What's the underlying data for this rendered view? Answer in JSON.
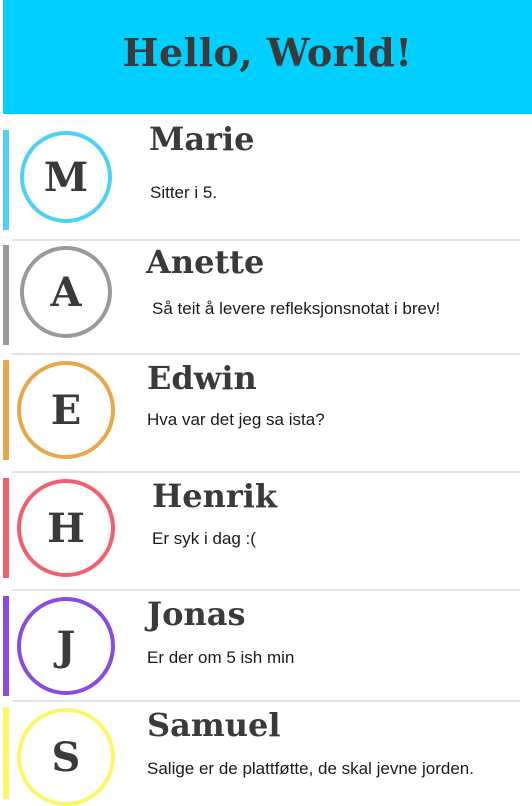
{
  "header": {
    "title": "Hello, World!"
  },
  "contacts": [
    {
      "initial": "M",
      "name": "Marie",
      "message": "Sitter i 5.",
      "color": "#4fd0f5"
    },
    {
      "initial": "A",
      "name": "Anette",
      "message": "Så teit å levere refleksjonsnotat i brev!",
      "color": "#9a9a9a"
    },
    {
      "initial": "E",
      "name": "Edwin",
      "message": "Hva var det jeg sa ista?",
      "color": "#e8a84a"
    },
    {
      "initial": "H",
      "name": "Henrik",
      "message": "Er syk i dag :(",
      "color": "#f2606e"
    },
    {
      "initial": "J",
      "name": "Jonas",
      "message": "Er der om 5 ish min",
      "color": "#8a4be3"
    },
    {
      "initial": "S",
      "name": "Samuel",
      "message": "Salige er de plattføtte, de skal jevne jorden.",
      "color": "#fdf766"
    }
  ]
}
